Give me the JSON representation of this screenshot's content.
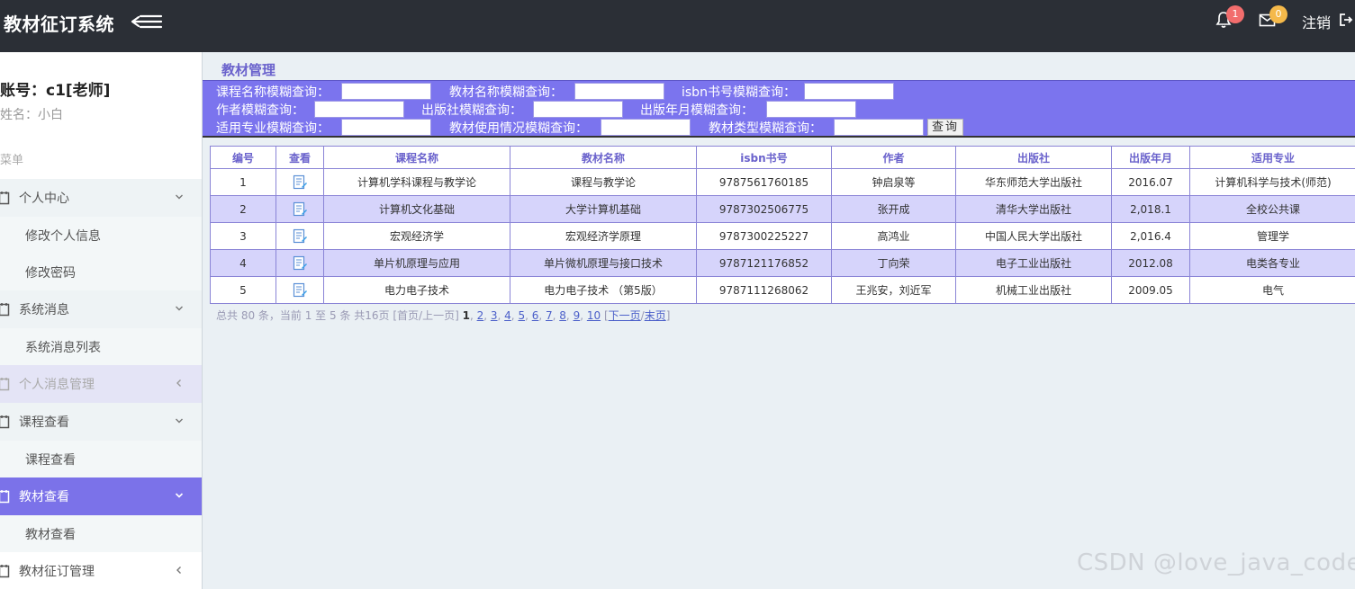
{
  "header": {
    "title": "教材征订系统",
    "notifications_badge": "1",
    "messages_badge": "0",
    "logout_label": "注销"
  },
  "sidebar": {
    "account": "账号：c1[老师]",
    "name": "姓名：小白",
    "menu_caption": "菜单",
    "groups": [
      {
        "label": "个人中心",
        "subs": [
          "修改个人信息",
          "修改密码"
        ]
      },
      {
        "label": "系统消息",
        "subs": [
          "系统消息列表"
        ]
      },
      {
        "label": "个人消息管理",
        "subs": []
      },
      {
        "label": "课程查看",
        "subs": [
          "课程查看"
        ]
      },
      {
        "label": "教材查看",
        "subs": [
          "教材查看"
        ]
      },
      {
        "label": "教材征订管理",
        "subs": []
      }
    ]
  },
  "main": {
    "title": "教材管理",
    "search": {
      "course_label": "课程名称模糊查询：",
      "textbook_label": "教材名称模糊查询：",
      "isbn_label": "isbn书号模糊查询：",
      "author_label": "作者模糊查询：",
      "publisher_label": "出版社模糊查询：",
      "pubdate_label": "出版年月模糊查询：",
      "major_label": "适用专业模糊查询：",
      "usage_label": "教材使用情况模糊查询：",
      "type_label": "教材类型模糊查询：",
      "button": "查询"
    },
    "table": {
      "columns": [
        "编号",
        "查看",
        "课程名称",
        "教材名称",
        "isbn书号",
        "作者",
        "出版社",
        "出版年月",
        "适用专业"
      ],
      "rows": [
        {
          "id": "1",
          "course": "计算机学科课程与教学论",
          "textbook": "课程与教学论",
          "isbn": "9787561760185",
          "author": "钟启泉等",
          "publisher": "华东师范大学出版社",
          "date": "2016.07",
          "major": "计算机科学与技术(师范)"
        },
        {
          "id": "2",
          "course": "计算机文化基础",
          "textbook": "大学计算机基础",
          "isbn": "9787302506775",
          "author": "张开成",
          "publisher": "清华大学出版社",
          "date": "2,018.1",
          "major": "全校公共课"
        },
        {
          "id": "3",
          "course": "宏观经济学",
          "textbook": "宏观经济学原理",
          "isbn": "9787300225227",
          "author": "高鸿业",
          "publisher": "中国人民大学出版社",
          "date": "2,016.4",
          "major": "管理学"
        },
        {
          "id": "4",
          "course": "单片机原理与应用",
          "textbook": "单片微机原理与接口技术",
          "isbn": "9787121176852",
          "author": "丁向荣",
          "publisher": "电子工业出版社",
          "date": "2012.08",
          "major": "电类各专业"
        },
        {
          "id": "5",
          "course": "电力电子技术",
          "textbook": "电力电子技术 （第5版）",
          "isbn": "9787111268062",
          "author": "王兆安，刘近军",
          "publisher": "机械工业出版社",
          "date": "2009.05",
          "major": "电气"
        }
      ]
    },
    "pager": {
      "summary": "总共 80 条，当前 1 至 5 条 共16页",
      "first_prev": "[首页/上一页]",
      "current": "1",
      "pages": [
        "2",
        "3",
        "4",
        "5",
        "6",
        "7",
        "8",
        "9",
        "10"
      ],
      "next_last_open": "[",
      "next": "下一页",
      "sep": "/",
      "last": "末页",
      "close": "]"
    }
  },
  "watermark": "CSDN @love_java_code",
  "colors": {
    "header_bg": "#2b2f36",
    "accent": "#7b72e9",
    "search_bg": "#7b74ee",
    "row_alt": "#d6d4fb",
    "badge_red": "#f26d6d",
    "badge_orange": "#f5b94a"
  }
}
